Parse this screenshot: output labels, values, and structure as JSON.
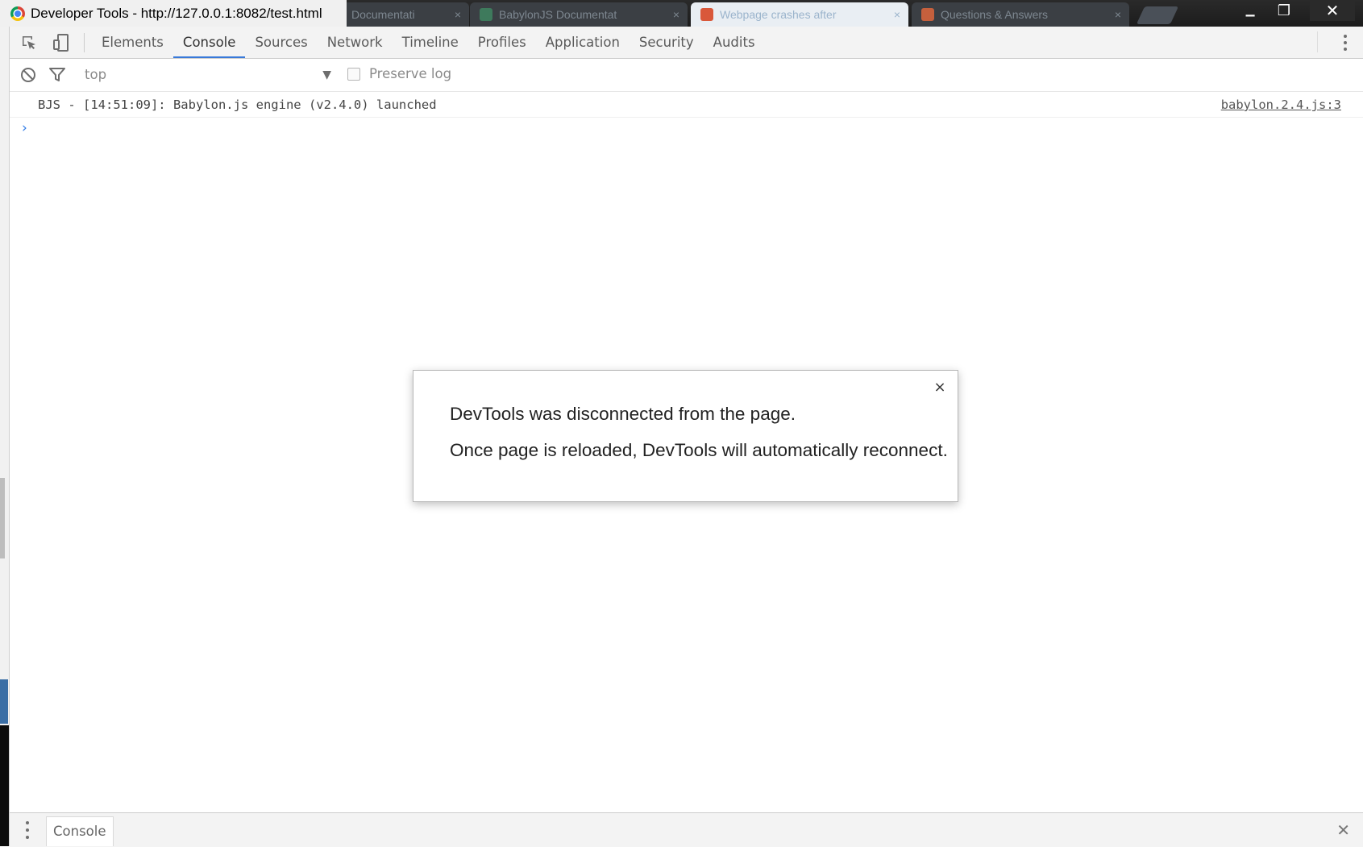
{
  "window": {
    "title": "Developer Tools - http://127.0.0.1:8082/test.html",
    "tabs": [
      {
        "label": "Documentati",
        "favicon_color": "#5b6f8a"
      },
      {
        "label": "BabylonJS Documentat",
        "favicon_color": "#3e7a5c"
      },
      {
        "label": "Webpage crashes after",
        "favicon_color": "#d9583a",
        "active": true
      },
      {
        "label": "Questions & Answers",
        "favicon_color": "#c5603d"
      }
    ],
    "tab_close_glyph": "×",
    "controls": {
      "minimize": "▁",
      "maximize": "❐",
      "close": "✕"
    }
  },
  "toolbar": {
    "icons": [
      "inspect-element-icon",
      "device-toolbar-icon"
    ],
    "tabs": [
      "Elements",
      "Console",
      "Sources",
      "Network",
      "Timeline",
      "Profiles",
      "Application",
      "Security",
      "Audits"
    ],
    "selected_tab": "Console"
  },
  "filterbar": {
    "context": "top",
    "preserve_log_label": "Preserve log",
    "preserve_log_checked": false
  },
  "console": {
    "messages": [
      {
        "text": "BJS - [14:51:09]: Babylon.js engine (v2.4.0) launched",
        "source": "babylon.2.4.js:3"
      }
    ],
    "prompt_glyph": "›"
  },
  "dialog": {
    "line1": "DevTools was disconnected from the page.",
    "line2": "Once page is reloaded, DevTools will automatically reconnect.",
    "close_glyph": "×"
  },
  "drawer": {
    "tab_label": "Console",
    "close_glyph": "✕"
  },
  "colors": {
    "accent": "#3879d9",
    "prompt": "#2f7be6",
    "toolbar_bg": "#f3f3f3"
  }
}
